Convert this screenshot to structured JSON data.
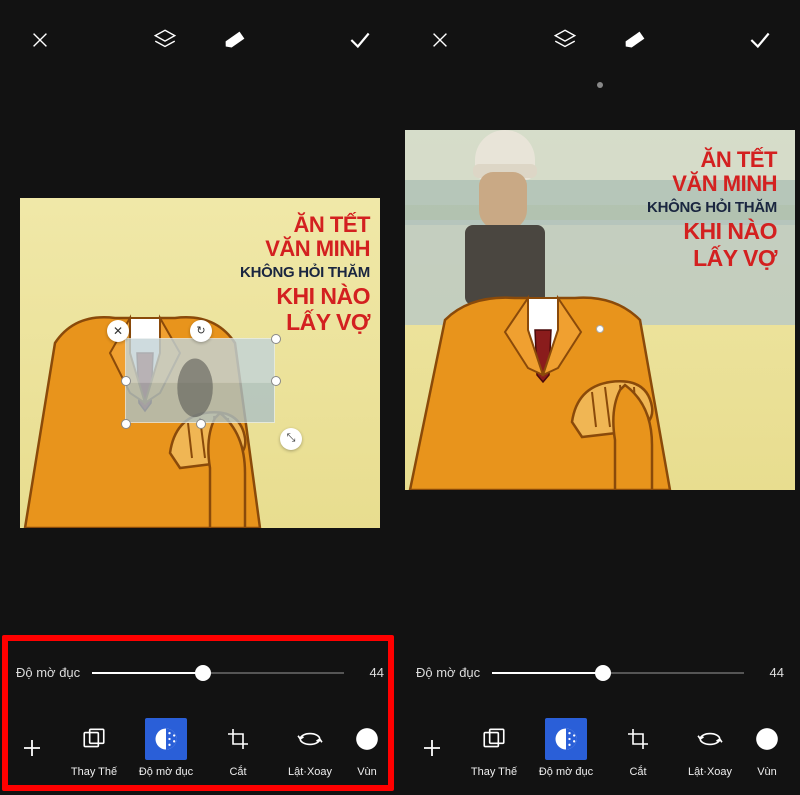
{
  "topbar": {
    "close": "✕",
    "layers": "layers",
    "eraser": "eraser",
    "apply": "✓"
  },
  "meme": {
    "line1a": "ĂN TẾT",
    "line1b": "VĂN MINH",
    "line2": "KHÔNG HỎI THĂM",
    "line3a": "KHI NÀO",
    "line3b": "LẤY VỢ"
  },
  "slider": {
    "label": "Độ mờ đục",
    "value": "44"
  },
  "tools": {
    "add": "+",
    "replace": "Thay Thế",
    "opacity": "Độ mờ đục",
    "crop": "Cắt",
    "flip_rotate": "Lật·Xoay",
    "blend": "Vùn"
  }
}
